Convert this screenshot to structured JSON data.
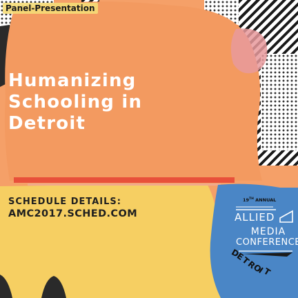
{
  "tag": "Panel-Presentation",
  "title": {
    "lines": [
      "Humanizing",
      "Schooling in",
      "Detroit"
    ]
  },
  "schedule": {
    "label": "SCHEDULE DETAILS:",
    "url": "AMC2017.SCHED.COM"
  },
  "logo": {
    "edition": "19",
    "edition_suffix": "TH",
    "edition_text": "ANNUAL",
    "line1": "ALLIED",
    "line2": "MEDIA",
    "line3": "CONFERENCE",
    "city_letters": [
      "D",
      "E",
      "T",
      "R",
      "O",
      "I",
      "T"
    ]
  },
  "colors": {
    "orange": "#f39a60",
    "blue": "#4a86c6",
    "yellow": "#f6cf62",
    "red": "#e8503a",
    "pink": "#e79a9c",
    "ink": "#1f1f1f"
  }
}
